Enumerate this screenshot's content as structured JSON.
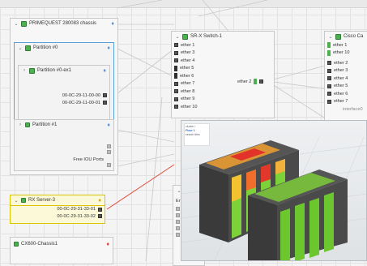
{
  "primequest": {
    "title": "PRIMEQUEST 280083 chassis",
    "partition0": {
      "title": "Partition #0"
    },
    "partition0ex1": {
      "title": "Partition #0-ex1",
      "macs": [
        "00-0C-29-11-00-00",
        "00-0C-29-11-00-01"
      ]
    },
    "partition1": {
      "title": "Partition #1"
    },
    "free_ports_label": "Free IOU Ports"
  },
  "rx_server": {
    "title": "RX Server-3",
    "macs": [
      "00-0C-29-31-33-01",
      "00-0C-29-31-33-02"
    ]
  },
  "cx600": {
    "title": "CX600-Chassis1"
  },
  "switch1": {
    "title": "SR-X Switch-1",
    "ports": [
      "ether 1",
      "ether 3",
      "ether 4",
      "ether 5",
      "ether 6",
      "ether 7",
      "ether 8",
      "ether 9",
      "ether 10"
    ],
    "side_port": "ether 2"
  },
  "cisco": {
    "title": "Cisco Ca",
    "ports_top": [
      "ether 1",
      "ether 10"
    ],
    "ports_list": [
      "ether 2",
      "ether 3",
      "ether 4",
      "ether 5",
      "ether 6",
      "ether 7"
    ],
    "last_port": "interface0"
  },
  "hidden_panel": {
    "label": "Er"
  },
  "heatmap": {
    "legend": [
      "cluster / ",
      "Floor 1 ",
      "search tiles"
    ]
  },
  "colors": {
    "accent": "#5aa0d8",
    "alert": "#e53935",
    "green": "#4caf50",
    "red_link": "#e04b3a"
  }
}
